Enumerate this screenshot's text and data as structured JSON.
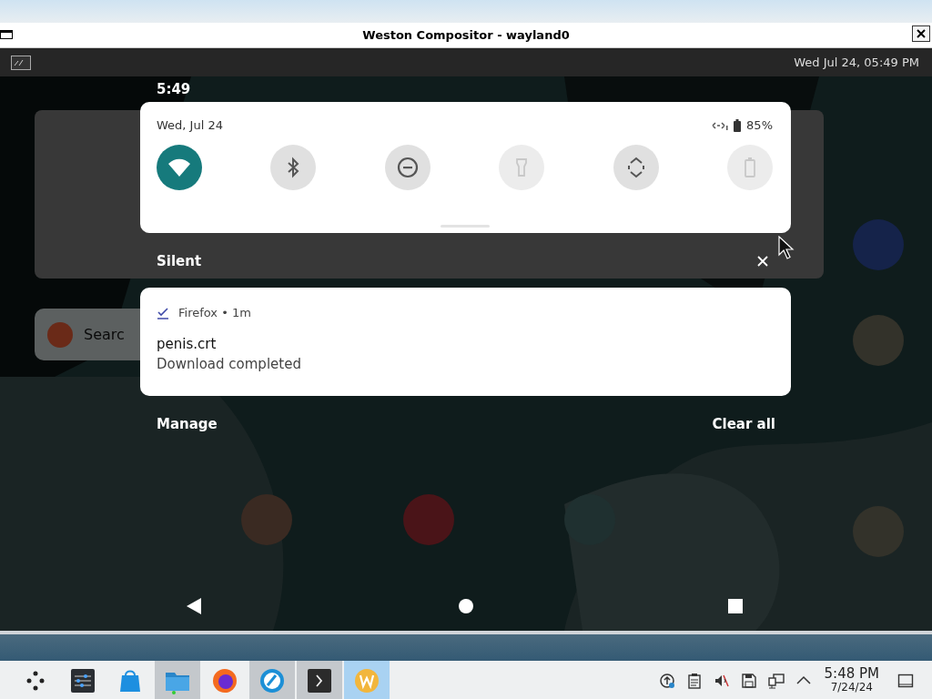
{
  "window": {
    "title": "Weston Compositor - wayland0"
  },
  "weston_panel": {
    "clock": "Wed Jul 24, 05:49 PM"
  },
  "android": {
    "status_time": "5:49",
    "home_search": {
      "placeholder": "Searc"
    },
    "quick_settings": {
      "date": "Wed, Jul 24",
      "battery": "85%",
      "tiles": [
        {
          "kind": "wifi",
          "on": true,
          "disabled": false
        },
        {
          "kind": "bluetooth",
          "on": false,
          "disabled": false
        },
        {
          "kind": "dnd",
          "on": false,
          "disabled": false
        },
        {
          "kind": "flashlight",
          "on": false,
          "disabled": true
        },
        {
          "kind": "rotate",
          "on": false,
          "disabled": false
        },
        {
          "kind": "battery",
          "on": false,
          "disabled": true
        }
      ]
    },
    "section": {
      "title": "Silent"
    },
    "notification": {
      "app": "Firefox • 1m",
      "title": "penis.crt",
      "text": "Download completed"
    },
    "actions": [
      "Manage",
      "Clear all"
    ]
  },
  "taskbar": {
    "apps": [
      {
        "kind": "launcher",
        "open": false,
        "focused": false
      },
      {
        "kind": "mixer",
        "open": false,
        "focused": false
      },
      {
        "kind": "store",
        "open": false,
        "focused": false
      },
      {
        "kind": "files",
        "open": true,
        "focused": false
      },
      {
        "kind": "firefox",
        "open": false,
        "focused": false
      },
      {
        "kind": "bluecircle",
        "open": true,
        "focused": false
      },
      {
        "kind": "terminal",
        "open": true,
        "focused": false
      },
      {
        "kind": "wapp",
        "open": true,
        "focused": true
      }
    ],
    "tray": [
      {
        "kind": "update"
      },
      {
        "kind": "clipboard"
      },
      {
        "kind": "muted"
      },
      {
        "kind": "save"
      },
      {
        "kind": "network"
      },
      {
        "kind": "caret"
      }
    ],
    "time": "5:48 PM",
    "date": "7/24/24"
  }
}
